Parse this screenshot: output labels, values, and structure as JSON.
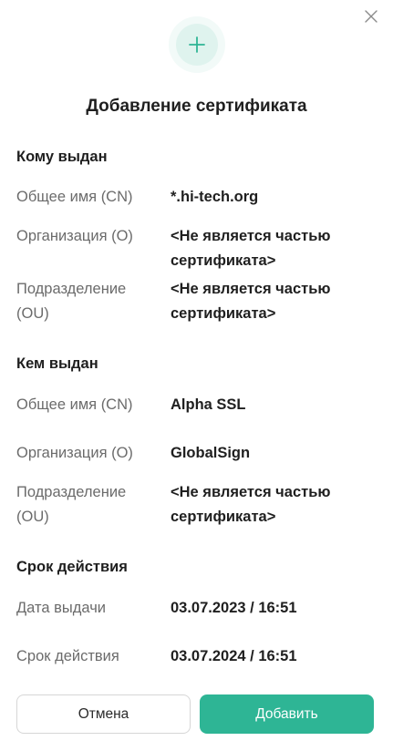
{
  "dialog": {
    "title": "Добавление сертификата"
  },
  "issued_to": {
    "heading": "Кому выдан",
    "rows": [
      {
        "label": "Общее имя (CN)",
        "value": "*.hi-tech.org"
      },
      {
        "label": "Организация (O)",
        "value": "<Не является частью сертификата>"
      },
      {
        "label": "Подразделение (OU)",
        "value": "<Не является частью сертификата>"
      }
    ]
  },
  "issued_by": {
    "heading": "Кем выдан",
    "rows": [
      {
        "label": "Общее имя (CN)",
        "value": "Alpha SSL"
      },
      {
        "label": "Организация (O)",
        "value": "GlobalSign"
      },
      {
        "label": "Подразделение (OU)",
        "value": "<Не является частью сертификата>"
      }
    ]
  },
  "validity": {
    "heading": "Срок действия",
    "rows": [
      {
        "label": "Дата выдачи",
        "value": "03.07.2023 / 16:51"
      },
      {
        "label": "Срок действия",
        "value": "03.07.2024 / 16:51"
      }
    ]
  },
  "buttons": {
    "cancel_label": "Отмена",
    "add_label": "Добавить"
  },
  "colors": {
    "accent": "#2eb595",
    "icon_bg": "#dff3ee"
  },
  "icons": {
    "close": "close-icon",
    "header": "plus-icon"
  }
}
